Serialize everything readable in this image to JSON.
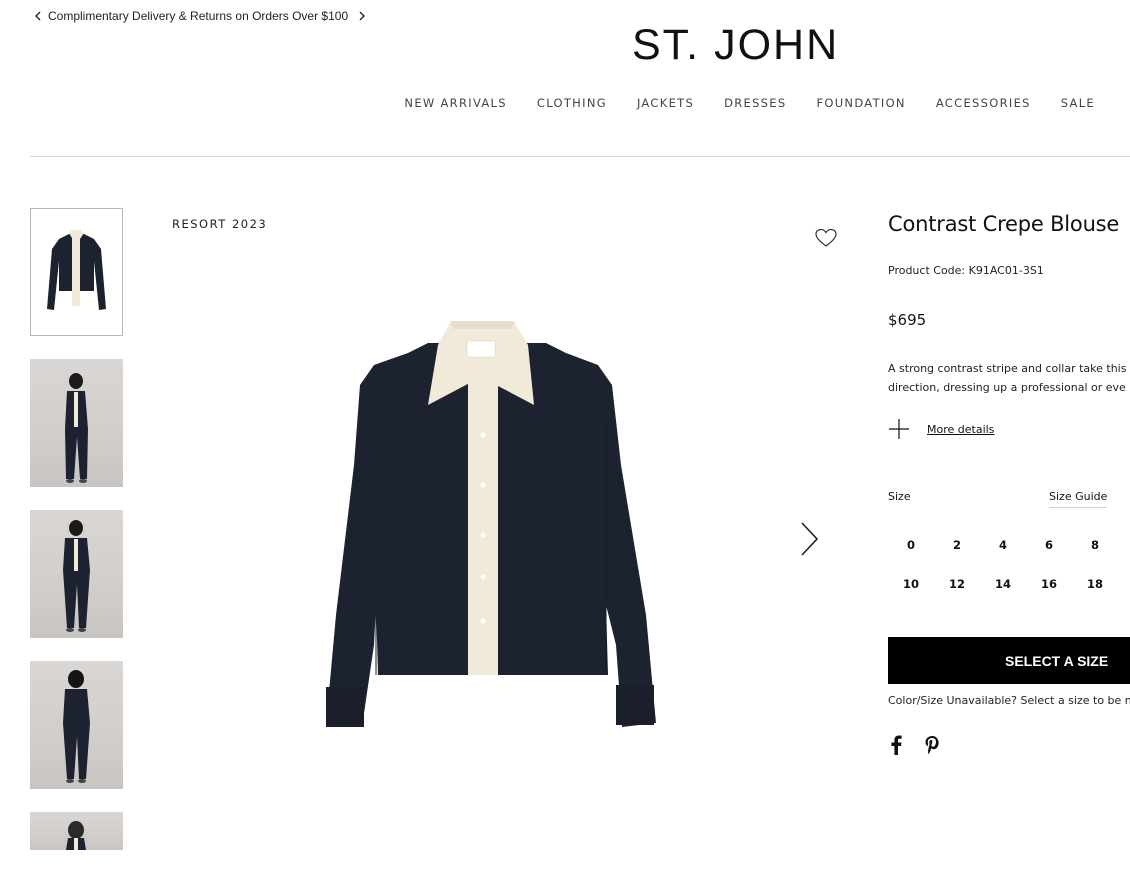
{
  "promo": {
    "text": "Complimentary Delivery & Returns on Orders Over $100",
    "prev_icon": "chevron-left-icon",
    "next_icon": "chevron-right-icon"
  },
  "brand": {
    "logo_text": "ST. JOHN"
  },
  "nav": {
    "items": [
      {
        "label": "NEW ARRIVALS"
      },
      {
        "label": "CLOTHING"
      },
      {
        "label": "JACKETS"
      },
      {
        "label": "DRESSES"
      },
      {
        "label": "FOUNDATION"
      },
      {
        "label": "ACCESSORIES"
      },
      {
        "label": "SALE"
      }
    ]
  },
  "gallery": {
    "season_label": "RESORT 2023",
    "thumbnails": [
      {
        "kind": "product-flat"
      },
      {
        "kind": "model-front"
      },
      {
        "kind": "model-front-full"
      },
      {
        "kind": "model-back"
      },
      {
        "kind": "model-detail"
      }
    ],
    "wishlist_icon": "heart-icon",
    "next_icon": "chevron-right-icon"
  },
  "product": {
    "title": "Contrast Crepe Blouse",
    "code": "Product Code: K91AC01-3S1",
    "price": "$695",
    "description_line1": "A strong contrast stripe and collar take this",
    "description_line2": "direction, dressing up a professional or eve",
    "more_details": "More details",
    "size_label": "Size",
    "size_guide": "Size Guide",
    "sizes": [
      "0",
      "2",
      "4",
      "6",
      "8",
      "10",
      "12",
      "14",
      "16",
      "18"
    ],
    "cta": "SELECT A SIZE",
    "unavailable_note": "Color/Size Unavailable? Select a size to be n",
    "colors": {
      "navy": "#1c2230",
      "cream": "#f1ead9",
      "cta_bg": "#000000"
    }
  },
  "social": {
    "icons": [
      "facebook-icon",
      "pinterest-icon"
    ]
  }
}
